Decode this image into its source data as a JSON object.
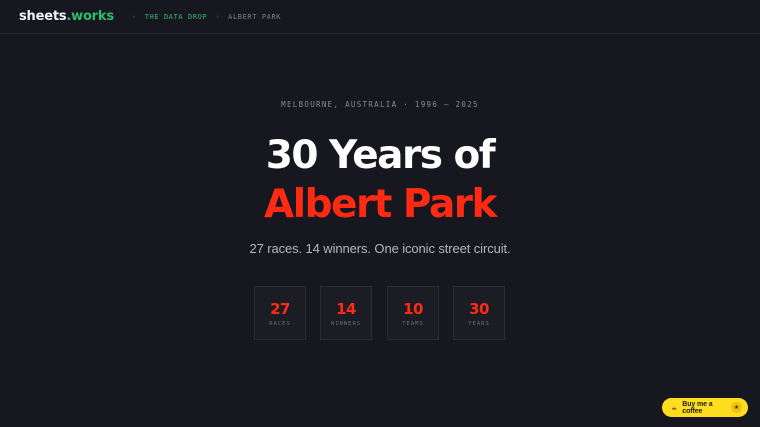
{
  "nav": {
    "logo_part1": "sheets",
    "logo_dot": ".",
    "logo_part2": "works",
    "separator": "›",
    "breadcrumb_section": "THE DATA DROP",
    "breadcrumb_current": "ALBERT PARK"
  },
  "hero": {
    "eyebrow": "MELBOURNE, AUSTRALIA · 1996 – 2025",
    "title_line1": "30 Years of",
    "title_line2": "Albert Park",
    "subtitle": "27 races. 14 winners. One iconic street circuit."
  },
  "stats": [
    {
      "value": "27",
      "label": "RACES"
    },
    {
      "value": "14",
      "label": "WINNERS"
    },
    {
      "value": "10",
      "label": "TEAMS"
    },
    {
      "value": "30",
      "label": "YEARS"
    }
  ],
  "coffee": {
    "icon": "coffee-cup-icon",
    "label": "Buy me a coffee",
    "badge_icon": "star-icon"
  },
  "colors": {
    "accent_red": "#ff2a14",
    "accent_green": "#2bbd6e",
    "background": "#17171f",
    "coffee_yellow": "#ffdd1f"
  }
}
